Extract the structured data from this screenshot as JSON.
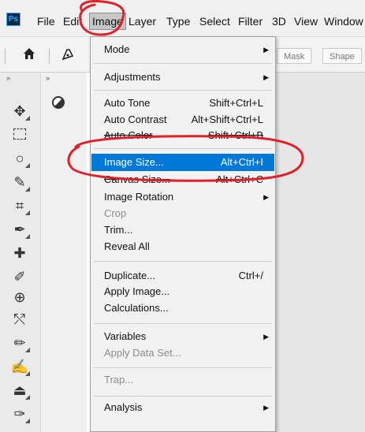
{
  "menubar": {
    "logo": "Ps",
    "items": [
      "File",
      "Edit",
      "Image",
      "Layer",
      "Type",
      "Select",
      "Filter",
      "3D",
      "View",
      "Window"
    ]
  },
  "optionsbar": {
    "mask_label": "Mask",
    "shape_label": "Shape"
  },
  "image_menu": {
    "mode": "Mode",
    "adjustments": "Adjustments",
    "auto_tone": "Auto Tone",
    "auto_tone_sc": "Shift+Ctrl+L",
    "auto_contrast": "Auto Contrast",
    "auto_contrast_sc": "Alt+Shift+Ctrl+L",
    "auto_color": "Auto Color",
    "auto_color_sc": "Shift+Ctrl+B",
    "image_size": "Image Size...",
    "image_size_sc": "Alt+Ctrl+I",
    "canvas_size": "Canvas Size...",
    "canvas_size_sc": "Alt+Ctrl+C",
    "image_rotation": "Image Rotation",
    "crop": "Crop",
    "trim": "Trim...",
    "reveal_all": "Reveal All",
    "duplicate": "Duplicate...",
    "duplicate_sc": "Ctrl+/",
    "apply_image": "Apply Image...",
    "calculations": "Calculations...",
    "variables": "Variables",
    "apply_data_set": "Apply Data Set...",
    "trap": "Trap...",
    "analysis": "Analysis"
  },
  "colors": {
    "highlight": "#0078d7",
    "annotation": "#e0202a"
  }
}
